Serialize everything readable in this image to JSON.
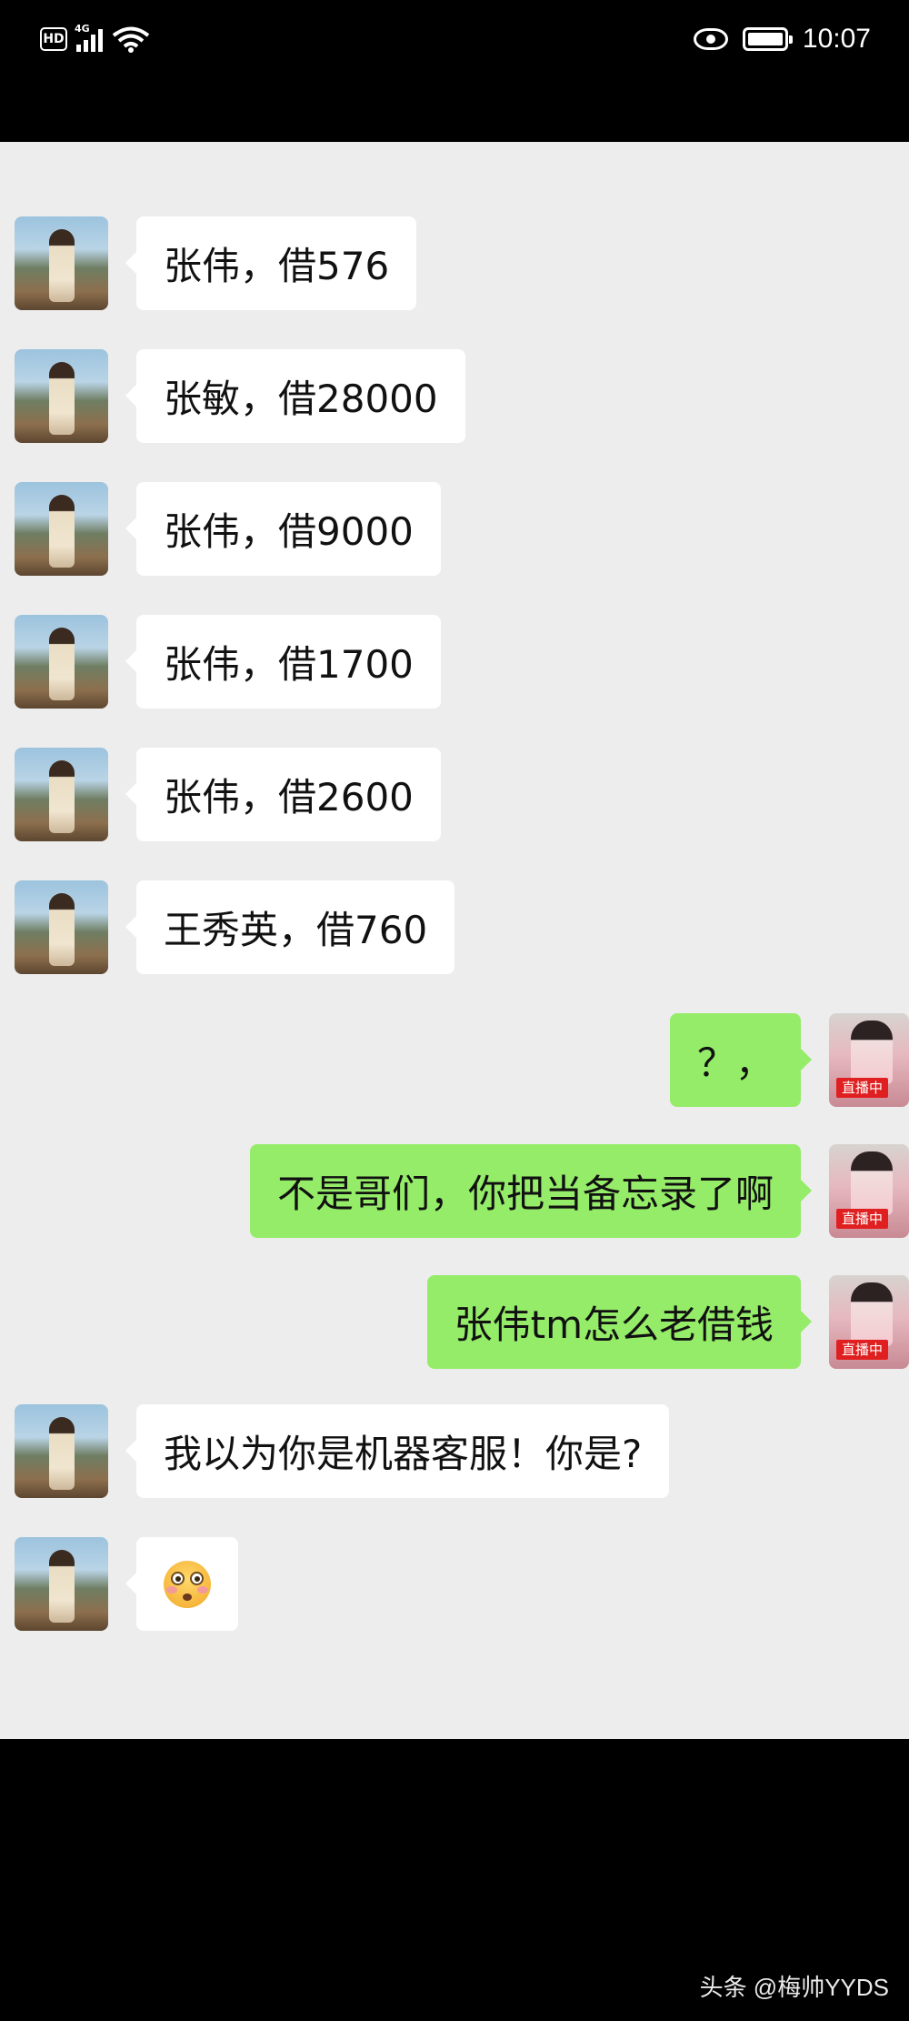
{
  "status_bar": {
    "hd": "HD",
    "network": "4G",
    "time": "10:07",
    "icons": [
      "hd-icon",
      "signal-icon",
      "wifi-icon",
      "eye-icon",
      "battery-icon"
    ]
  },
  "messages": [
    {
      "side": "in",
      "text": "张伟，借576"
    },
    {
      "side": "in",
      "text": "张敏，借28000"
    },
    {
      "side": "in",
      "text": "张伟，借9000"
    },
    {
      "side": "in",
      "text": "张伟，借1700"
    },
    {
      "side": "in",
      "text": "张伟，借2600"
    },
    {
      "side": "in",
      "text": "王秀英，借760"
    },
    {
      "side": "out",
      "text": "？，"
    },
    {
      "side": "out",
      "text": "不是哥们，你把当备忘录了啊"
    },
    {
      "side": "out",
      "text": "张伟tm怎么老借钱"
    },
    {
      "side": "in",
      "text": "我以为你是机器客服！你是?"
    },
    {
      "side": "in",
      "emoji": "flushed-face-emoji"
    }
  ],
  "live_badge": "直播中",
  "colors": {
    "out_bubble": "#95ec69",
    "in_bubble": "#ffffff",
    "chat_bg": "#ededed",
    "live": "#e02020"
  },
  "watermark": "头条 @梅帅YYDS"
}
